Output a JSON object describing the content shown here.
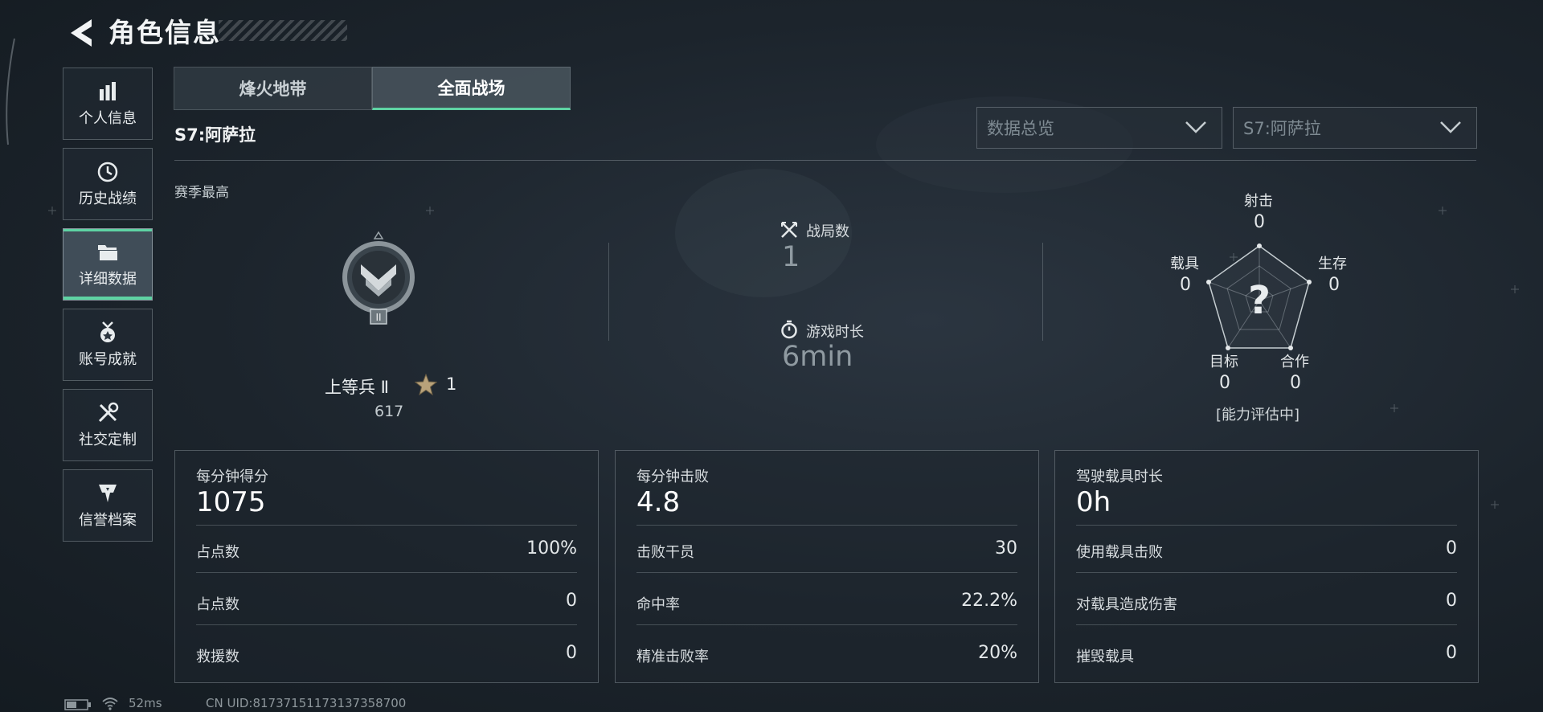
{
  "header": {
    "title": "角色信息"
  },
  "sidebar": {
    "items": [
      {
        "label": "个人信息",
        "icon": "bar-chart-icon"
      },
      {
        "label": "历史战绩",
        "icon": "history-clock-icon"
      },
      {
        "label": "详细数据",
        "icon": "folder-icon",
        "active": true
      },
      {
        "label": "账号成就",
        "icon": "medal-icon"
      },
      {
        "label": "社交定制",
        "icon": "tools-icon"
      },
      {
        "label": "信誉档案",
        "icon": "emblem-icon"
      }
    ]
  },
  "tabs": [
    {
      "label": "烽火地带",
      "active": false
    },
    {
      "label": "全面战场",
      "active": true
    }
  ],
  "season_name": "S7:阿萨拉",
  "filters": {
    "view": {
      "value": "数据总览"
    },
    "season": {
      "value": "S7:阿萨拉"
    }
  },
  "season_best": {
    "label": "赛季最高",
    "rank_name": "上等兵 Ⅱ",
    "rank_tier": "II",
    "stars": "1",
    "score": "617"
  },
  "summary": {
    "matches_label": "战局数",
    "matches_value": "1",
    "playtime_label": "游戏时长",
    "playtime_value": "6min"
  },
  "radar": {
    "axes": [
      {
        "label": "射击",
        "value": "0"
      },
      {
        "label": "生存",
        "value": "0"
      },
      {
        "label": "合作",
        "value": "0"
      },
      {
        "label": "目标",
        "value": "0"
      },
      {
        "label": "载具",
        "value": "0"
      }
    ],
    "center_mark": "?",
    "status": "[能力评估中]"
  },
  "cards": [
    {
      "title": "每分钟得分",
      "value": "1075",
      "rows": [
        {
          "label": "占点数",
          "value": "100%"
        },
        {
          "label": "占点数",
          "value": "0"
        },
        {
          "label": "救援数",
          "value": "0"
        }
      ]
    },
    {
      "title": "每分钟击败",
      "value": "4.8",
      "rows": [
        {
          "label": "击败干员",
          "value": "30"
        },
        {
          "label": "命中率",
          "value": "22.2%"
        },
        {
          "label": "精准击败率",
          "value": "20%"
        }
      ]
    },
    {
      "title": "驾驶载具时长",
      "value": "0h",
      "rows": [
        {
          "label": "使用载具击败",
          "value": "0"
        },
        {
          "label": "对载具造成伤害",
          "value": "0"
        },
        {
          "label": "摧毁载具",
          "value": "0"
        }
      ]
    }
  ],
  "status_bar": {
    "ping": "52ms",
    "uid": "CN UID:81737151173137358700"
  },
  "colors": {
    "accent": "#5ed3a3",
    "background": "#1c242c"
  }
}
